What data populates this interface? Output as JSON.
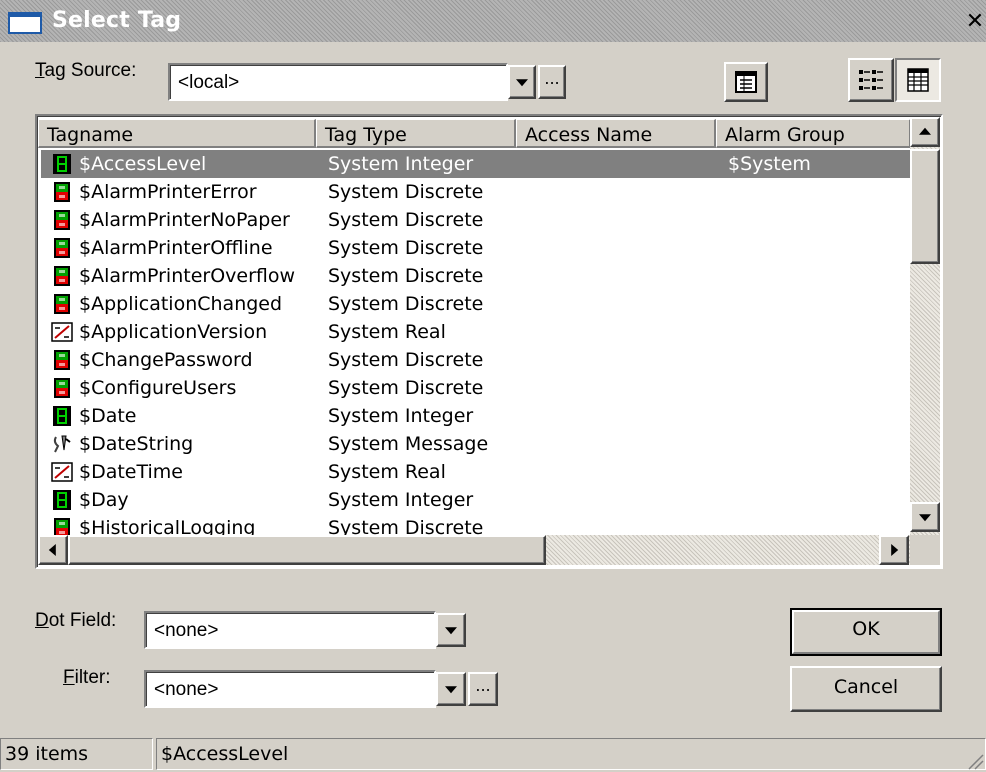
{
  "window": {
    "title": "Select Tag",
    "close_glyph": "✕"
  },
  "tag_source": {
    "label": "Tag Source:",
    "accel": "T",
    "label_rest": "ag Source:",
    "value": "<local>"
  },
  "dot_field": {
    "label_accel": "D",
    "label_rest": "ot Field:",
    "value": "<none>"
  },
  "filter": {
    "label_accel": "F",
    "label_rest": "ilter:",
    "value": "<none>"
  },
  "buttons": {
    "ellipsis": "...",
    "ok": "OK",
    "cancel": "Cancel"
  },
  "columns": [
    "Tagname",
    "Tag Type",
    "Access Name",
    "Alarm Group"
  ],
  "rows": [
    {
      "icon": "integer-tag-icon",
      "name": "$AccessLevel",
      "type": "System Integer",
      "access": "",
      "alarm": "$System",
      "selected": true
    },
    {
      "icon": "discrete-tag-icon",
      "name": "$AlarmPrinterError",
      "type": "System Discrete",
      "access": "",
      "alarm": ""
    },
    {
      "icon": "discrete-tag-icon",
      "name": "$AlarmPrinterNoPaper",
      "type": "System Discrete",
      "access": "",
      "alarm": ""
    },
    {
      "icon": "discrete-tag-icon",
      "name": "$AlarmPrinterOffline",
      "type": "System Discrete",
      "access": "",
      "alarm": ""
    },
    {
      "icon": "discrete-tag-icon",
      "name": "$AlarmPrinterOverflow",
      "type": "System Discrete",
      "access": "",
      "alarm": ""
    },
    {
      "icon": "discrete-tag-icon",
      "name": "$ApplicationChanged",
      "type": "System Discrete",
      "access": "",
      "alarm": ""
    },
    {
      "icon": "real-tag-icon",
      "name": "$ApplicationVersion",
      "type": "System Real",
      "access": "",
      "alarm": ""
    },
    {
      "icon": "discrete-tag-icon",
      "name": "$ChangePassword",
      "type": "System Discrete",
      "access": "",
      "alarm": ""
    },
    {
      "icon": "discrete-tag-icon",
      "name": "$ConfigureUsers",
      "type": "System Discrete",
      "access": "",
      "alarm": ""
    },
    {
      "icon": "integer-tag-icon",
      "name": "$Date",
      "type": "System Integer",
      "access": "",
      "alarm": ""
    },
    {
      "icon": "message-tag-icon",
      "name": "$DateString",
      "type": "System Message",
      "access": "",
      "alarm": ""
    },
    {
      "icon": "real-tag-icon",
      "name": "$DateTime",
      "type": "System Real",
      "access": "",
      "alarm": ""
    },
    {
      "icon": "integer-tag-icon",
      "name": "$Day",
      "type": "System Integer",
      "access": "",
      "alarm": ""
    },
    {
      "icon": "discrete-tag-icon",
      "name": "$HistoricalLogging",
      "type": "System Discrete",
      "access": "",
      "alarm": ""
    }
  ],
  "status": {
    "count": "39 items",
    "selected": "$AccessLevel"
  },
  "colors": {
    "selection": "#808080",
    "dialog": "#d4d0c8",
    "discrete_on": "#00a000",
    "discrete_off": "#e00000"
  }
}
